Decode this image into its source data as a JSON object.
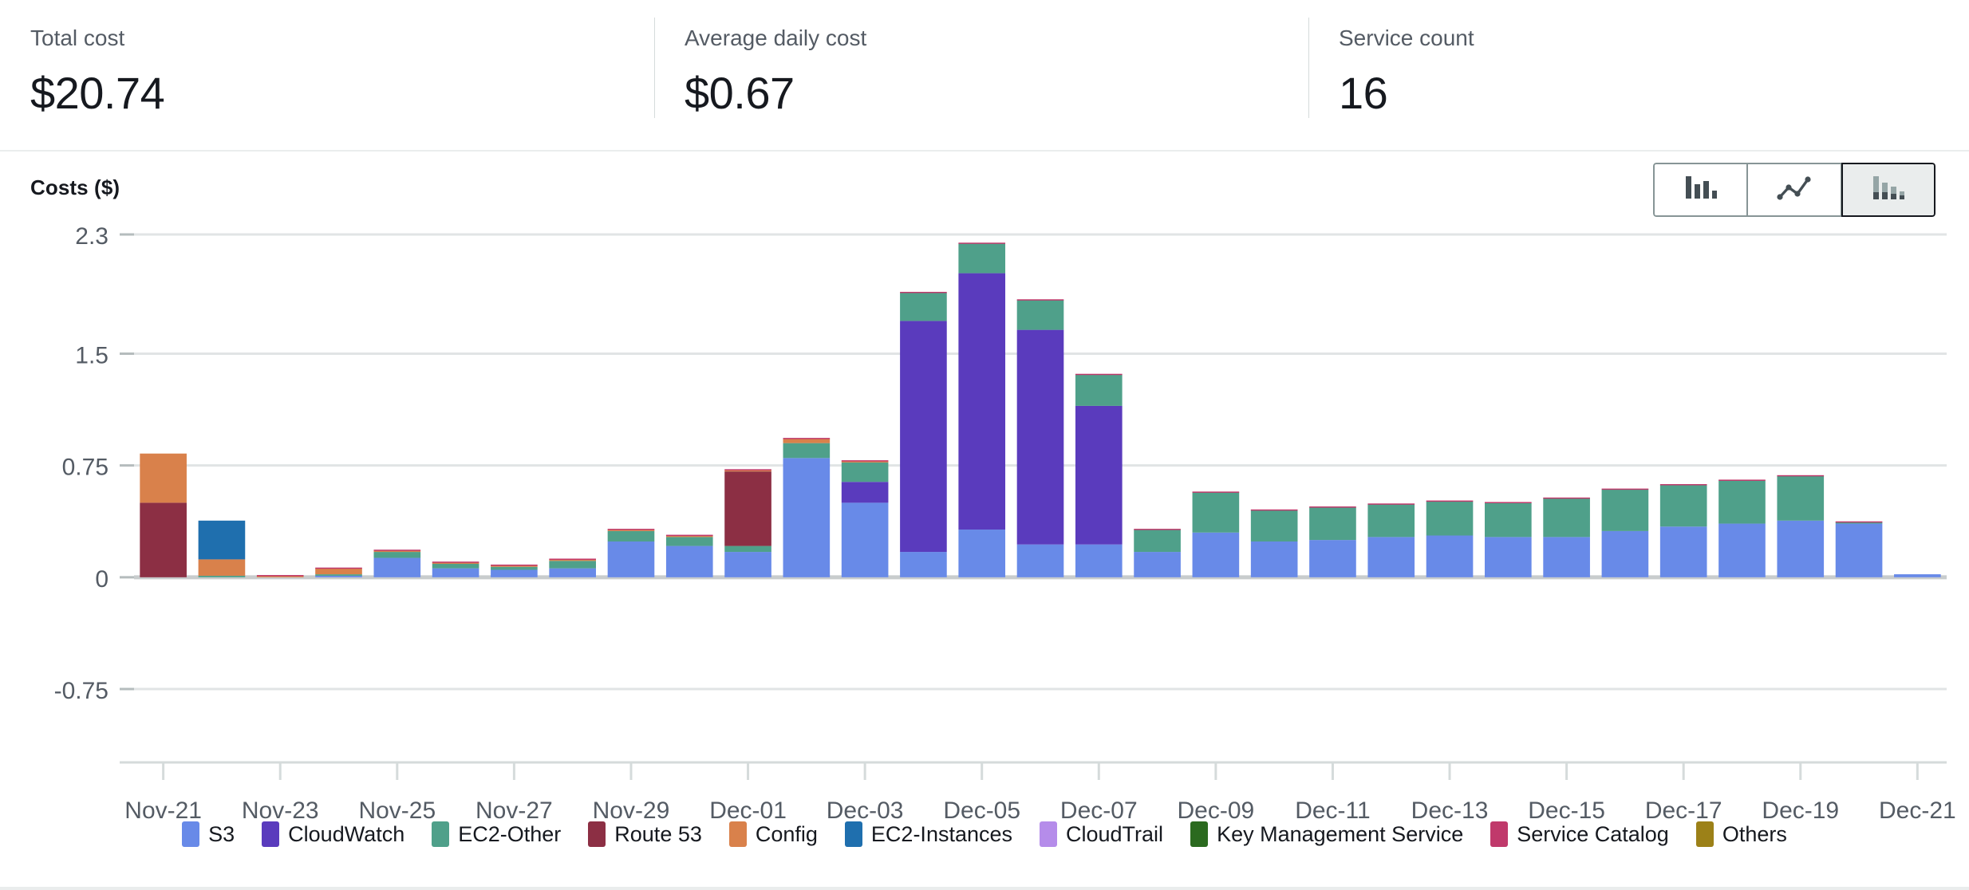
{
  "kpis": [
    {
      "label": "Total cost",
      "value": "$20.74",
      "name": "total-cost"
    },
    {
      "label": "Average daily cost",
      "value": "$0.67",
      "name": "average-daily-cost"
    },
    {
      "label": "Service count",
      "value": "16",
      "name": "service-count"
    }
  ],
  "chart_header": {
    "title": "Costs ($)",
    "toggles": [
      {
        "icon": "bar-chart-icon",
        "label": "Bar chart",
        "active": false
      },
      {
        "icon": "line-chart-icon",
        "label": "Line chart",
        "active": false
      },
      {
        "icon": "stacked-bar-chart-icon",
        "label": "Stacked bar chart",
        "active": true
      }
    ]
  },
  "chart_data": {
    "type": "bar",
    "stacked": true,
    "title": "Costs ($)",
    "xlabel": "",
    "ylabel": "Costs ($)",
    "ylim": [
      -0.75,
      2.3
    ],
    "yticks": [
      2.3,
      1.5,
      0.75,
      0,
      -0.75
    ],
    "ytick_labels": [
      "2.3",
      "1.5",
      "0.75",
      "0",
      "-0.75"
    ],
    "grid": true,
    "legend_position": "bottom",
    "categories": [
      "Nov-21",
      "Nov-22",
      "Nov-23",
      "Nov-24",
      "Nov-25",
      "Nov-26",
      "Nov-27",
      "Nov-28",
      "Nov-29",
      "Nov-30",
      "Dec-01",
      "Dec-02",
      "Dec-03",
      "Dec-04",
      "Dec-05",
      "Dec-06",
      "Dec-07",
      "Dec-08",
      "Dec-09",
      "Dec-10",
      "Dec-11",
      "Dec-12",
      "Dec-13",
      "Dec-14",
      "Dec-15",
      "Dec-16",
      "Dec-17",
      "Dec-18",
      "Dec-19",
      "Dec-20",
      "Dec-21"
    ],
    "tick_labels": [
      "Nov-21",
      "Nov-23",
      "Nov-25",
      "Nov-27",
      "Nov-29",
      "Dec-01",
      "Dec-03",
      "Dec-05",
      "Dec-07",
      "Dec-09",
      "Dec-11",
      "Dec-13",
      "Dec-15",
      "Dec-17",
      "Dec-19",
      "Dec-21"
    ],
    "series": [
      {
        "name": "S3",
        "color": "#688ae8",
        "values": [
          0,
          0,
          0,
          0.01,
          0.13,
          0.06,
          0.05,
          0.06,
          0.24,
          0.21,
          0.17,
          0.8,
          0.5,
          0.17,
          0.32,
          0.22,
          0.22,
          0.17,
          0.3,
          0.24,
          0.25,
          0.27,
          0.28,
          0.27,
          0.27,
          0.31,
          0.34,
          0.36,
          0.38,
          0.36,
          0.02
        ]
      },
      {
        "name": "CloudWatch",
        "color": "#5a3bbd",
        "values": [
          0,
          0,
          0,
          0,
          0,
          0,
          0,
          0,
          0,
          0,
          0,
          0,
          0.14,
          1.55,
          1.72,
          1.44,
          0.93,
          0,
          0,
          0,
          0,
          0,
          0,
          0,
          0,
          0,
          0,
          0,
          0,
          0,
          0
        ]
      },
      {
        "name": "EC2-Other",
        "color": "#4fa08a",
        "values": [
          0,
          0.01,
          0,
          0.01,
          0.04,
          0.03,
          0.02,
          0.05,
          0.07,
          0.06,
          0.04,
          0.1,
          0.13,
          0.19,
          0.2,
          0.2,
          0.21,
          0.15,
          0.27,
          0.21,
          0.22,
          0.22,
          0.23,
          0.23,
          0.26,
          0.28,
          0.28,
          0.29,
          0.3,
          0.01,
          0
        ]
      },
      {
        "name": "Route 53",
        "color": "#8c2f44",
        "values": [
          0.5,
          0,
          0,
          0,
          0,
          0,
          0,
          0,
          0,
          0,
          0.5,
          0,
          0,
          0,
          0,
          0,
          0,
          0,
          0,
          0,
          0,
          0,
          0,
          0,
          0,
          0,
          0,
          0,
          0,
          0,
          0
        ]
      },
      {
        "name": "Config",
        "color": "#d9814b",
        "values": [
          0.33,
          0.11,
          0.01,
          0.04,
          0.01,
          0.01,
          0.01,
          0.01,
          0.01,
          0.01,
          0.01,
          0.03,
          0.01,
          0,
          0,
          0,
          0,
          0,
          0,
          0,
          0,
          0,
          0,
          0,
          0,
          0,
          0,
          0,
          0,
          0,
          0
        ]
      },
      {
        "name": "EC2-Instances",
        "color": "#1f6fae",
        "values": [
          0,
          0.26,
          0,
          0,
          0,
          0,
          0,
          0,
          0,
          0,
          0,
          0,
          0,
          0,
          0,
          0,
          0,
          0,
          0,
          0,
          0,
          0,
          0,
          0,
          0,
          0,
          0,
          0,
          0,
          0,
          0
        ]
      },
      {
        "name": "CloudTrail",
        "color": "#b58cea",
        "values": [
          0,
          0,
          0,
          0,
          0,
          0,
          0,
          0,
          0,
          0,
          0,
          0,
          0,
          0,
          0,
          0,
          0,
          0,
          0,
          0,
          0,
          0,
          0,
          0,
          0,
          0,
          0,
          0,
          0,
          0,
          0
        ]
      },
      {
        "name": "Key Management Service",
        "color": "#2b6a1f",
        "values": [
          0,
          0,
          0,
          0,
          0,
          0,
          0,
          0,
          0,
          0,
          0,
          0,
          0,
          0,
          0,
          0,
          0,
          0,
          0,
          0,
          0,
          0,
          0,
          0,
          0,
          0,
          0,
          0,
          0,
          0,
          0
        ]
      },
      {
        "name": "Service Catalog",
        "color": "#c0396b",
        "values": [
          0,
          0,
          0.005,
          0.005,
          0.005,
          0.005,
          0.005,
          0.005,
          0.005,
          0.005,
          0.005,
          0.005,
          0.005,
          0.005,
          0.005,
          0.005,
          0.005,
          0.005,
          0.005,
          0.005,
          0.005,
          0.005,
          0.005,
          0.005,
          0.005,
          0.005,
          0.005,
          0.005,
          0.005,
          0.005,
          0
        ]
      },
      {
        "name": "Others",
        "color": "#9c8118",
        "values": [
          0,
          0,
          0,
          0,
          0,
          0,
          0,
          0,
          0,
          0,
          0,
          0,
          0,
          0,
          0,
          0,
          0,
          0,
          0,
          0,
          0,
          0,
          0,
          0,
          0,
          0,
          0,
          0,
          0,
          0,
          0
        ]
      }
    ]
  }
}
